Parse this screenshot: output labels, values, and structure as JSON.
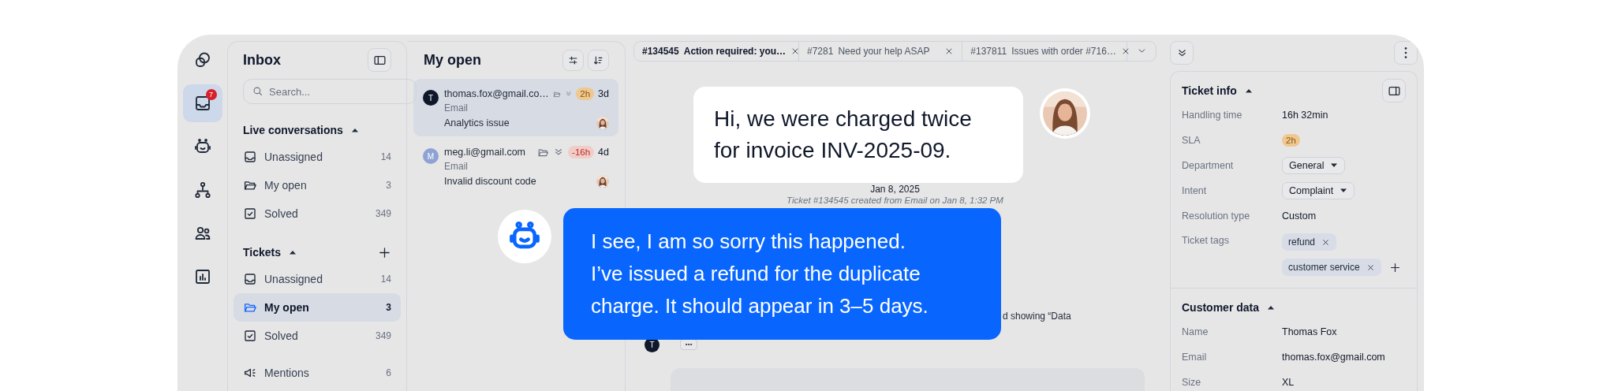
{
  "rail": {
    "items": [
      {
        "kind": "logo",
        "selected": false
      },
      {
        "kind": "inbox",
        "selected": true,
        "badge": "7"
      },
      {
        "kind": "bot",
        "selected": false
      },
      {
        "kind": "hierarchy",
        "selected": false
      },
      {
        "kind": "people",
        "selected": false
      },
      {
        "kind": "chart",
        "selected": false
      }
    ]
  },
  "inbox": {
    "title": "Inbox",
    "search": {
      "placeholder": "Search..."
    },
    "sections": [
      {
        "title": "Live conversations",
        "expanded": true,
        "can_add": false,
        "items": [
          {
            "kind": "tray",
            "label": "Unassigned",
            "count": "14",
            "selected": false
          },
          {
            "kind": "folder",
            "label": "My open",
            "count": "3",
            "selected": false
          },
          {
            "kind": "check",
            "label": "Solved",
            "count": "349",
            "selected": false
          }
        ]
      },
      {
        "title": "Tickets",
        "expanded": true,
        "can_add": true,
        "items": [
          {
            "kind": "tray",
            "label": "Unassigned",
            "count": "14",
            "selected": false
          },
          {
            "kind": "folder",
            "label": "My open",
            "count": "3",
            "selected": true
          },
          {
            "kind": "check",
            "label": "Solved",
            "count": "349",
            "selected": false
          }
        ]
      }
    ],
    "extra_items": [
      {
        "kind": "megaphone",
        "label": "Mentions",
        "count": "6",
        "selected": false
      }
    ]
  },
  "conversation_list": {
    "title": "My open",
    "items": [
      {
        "initial": "T",
        "color": "#0f172a",
        "email": "thomas.fox@gmail.co…",
        "channel": "Email",
        "subject": "Analytics issue",
        "sla": "2h",
        "overdue": false,
        "age": "3d",
        "selected": true
      },
      {
        "initial": "M",
        "color": "#8ea3d4",
        "email": "meg.li@gmail.com",
        "channel": "Email",
        "subject": "Invalid discount code",
        "sla": "-16h",
        "overdue": true,
        "age": "4d",
        "selected": false
      }
    ]
  },
  "tabs": [
    {
      "number": "#134545",
      "title": "Action required: you…",
      "selected": true
    },
    {
      "number": "#7281",
      "title": "Need your help ASAP",
      "selected": false
    },
    {
      "number": "#137811",
      "title": "Issues with order #716…",
      "selected": false
    }
  ],
  "chat": {
    "date": "Jan 8, 2025",
    "note": "Ticket #134545 created from Email on Jan 8, 1:32 PM",
    "partial_message": "d showing “Data",
    "author_initial": "T"
  },
  "overlay": {
    "customer_message": "Hi, we were charged twice for invoice INV-2025-09.",
    "agent_reply_lines": [
      "I see, I am so sorry this happened.",
      "I’ve issued a refund for the duplicate",
      "charge. It should appear in 3–5 days."
    ]
  },
  "ticket_info": {
    "title": "Ticket info",
    "expanded": true,
    "fields": [
      {
        "label": "Handling time",
        "kind": "text",
        "value": "16h 32min"
      },
      {
        "label": "SLA",
        "kind": "badge",
        "value": "2h"
      },
      {
        "label": "Department",
        "kind": "select",
        "value": "General"
      },
      {
        "label": "Intent",
        "kind": "select",
        "value": "Complaint"
      },
      {
        "label": "Resolution type",
        "kind": "text",
        "value": "Custom"
      },
      {
        "label": "Ticket tags",
        "kind": "tags",
        "tags": [
          "refund",
          "customer service"
        ]
      }
    ]
  },
  "customer_data": {
    "title": "Customer data",
    "expanded": true,
    "fields": [
      {
        "label": "Name",
        "kind": "text",
        "value": "Thomas Fox"
      },
      {
        "label": "Email",
        "kind": "text",
        "value": "thomas.fox@gmail.com"
      },
      {
        "label": "Size",
        "kind": "text",
        "value": "XL"
      }
    ]
  }
}
